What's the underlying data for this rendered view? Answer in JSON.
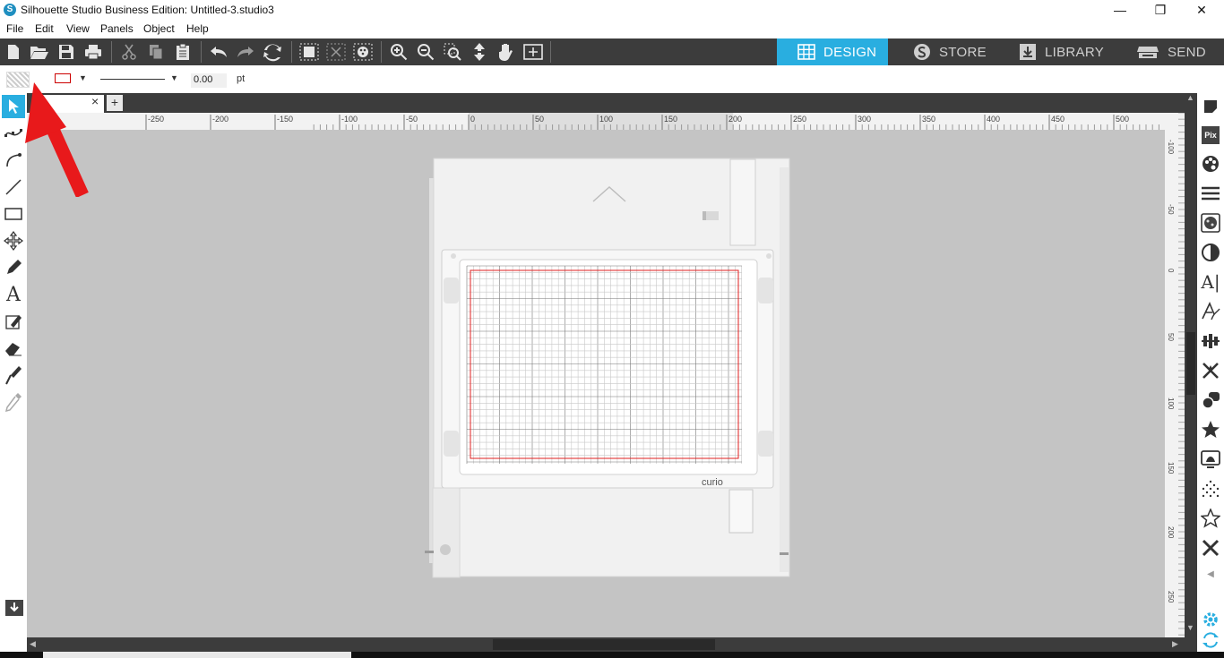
{
  "window": {
    "title": "Silhouette Studio Business Edition: Untitled-3.studio3",
    "minimize": "—",
    "restore": "❐",
    "close": "✕"
  },
  "menu": [
    "File",
    "Edit",
    "View",
    "Panels",
    "Object",
    "Help"
  ],
  "nav_tabs": [
    {
      "label": "DESIGN",
      "active": true,
      "icon": "grid-icon"
    },
    {
      "label": "STORE",
      "active": false,
      "icon": "silhouette-s-icon"
    },
    {
      "label": "LIBRARY",
      "active": false,
      "icon": "library-download-icon"
    },
    {
      "label": "SEND",
      "active": false,
      "icon": "cutter-icon"
    }
  ],
  "props": {
    "line_width": "0.00",
    "line_unit": "pt"
  },
  "doc_tabs": {
    "close": "×",
    "add": "+"
  },
  "rulers": {
    "h_labels": [
      "-250",
      "-200",
      "-150",
      "-100",
      "-50",
      "0",
      "50",
      "100",
      "150",
      "200",
      "250",
      "300",
      "350",
      "400",
      "450",
      "500"
    ],
    "v_labels": [
      "-100",
      "-50",
      "0",
      "50",
      "100",
      "150",
      "200",
      "250"
    ]
  },
  "machine": {
    "label": "curio"
  },
  "colors": {
    "accent": "#29aee0",
    "toolbar": "#3c3c3c",
    "canvas": "#c4c4c4",
    "cut_border": "#e02020",
    "arrow": "#e8191b"
  },
  "annotation": {
    "type": "red-arrow",
    "points_to": "open-button"
  }
}
